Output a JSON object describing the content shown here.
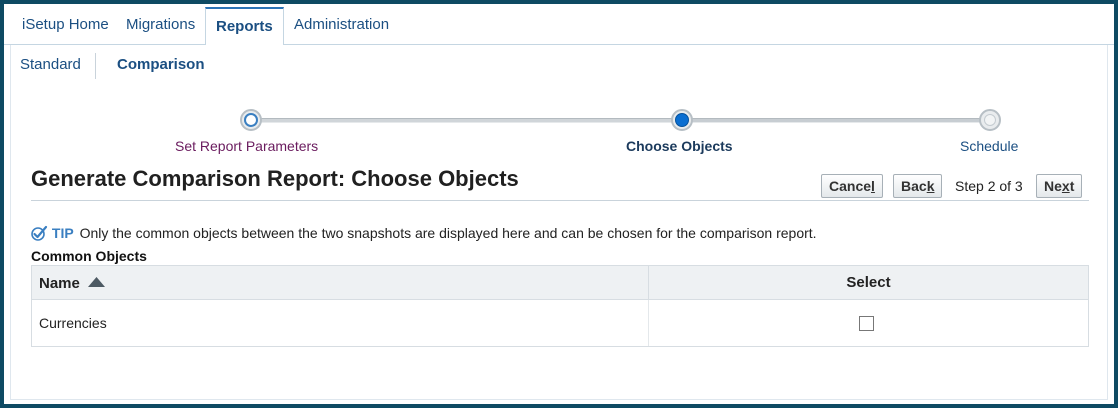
{
  "tabs": [
    {
      "label": "iSetup Home"
    },
    {
      "label": "Migrations"
    },
    {
      "label": "Reports",
      "active": true
    },
    {
      "label": "Administration"
    }
  ],
  "subtabs": [
    {
      "label": "Standard"
    },
    {
      "label": "Comparison",
      "active": true
    }
  ],
  "train": {
    "steps": [
      {
        "label": "Set Report Parameters",
        "state": "visited"
      },
      {
        "label": "Choose Objects",
        "state": "current"
      },
      {
        "label": "Schedule",
        "state": "future"
      }
    ]
  },
  "page": {
    "title": "Generate Comparison Report: Choose Objects",
    "buttons": {
      "cancel_main": "Cance",
      "cancel_key": "l",
      "back_main": "Bac",
      "back_key": "k",
      "next_main": "Ne",
      "next_key": "x",
      "next_tail": "t"
    },
    "step_text": "Step 2 of 3"
  },
  "tip": {
    "label": "TIP",
    "text": "Only the common objects between the two snapshots are displayed here and can be chosen for the comparison report."
  },
  "common_objects": {
    "title": "Common Objects",
    "columns": {
      "name": "Name",
      "select": "Select"
    },
    "rows": [
      {
        "name": "Currencies",
        "selected": false
      }
    ]
  },
  "colors": {
    "frame": "#0e4a63",
    "link": "#1b4f82",
    "visited_step": "#6a1b5e",
    "current_step": "#0a6ed1"
  },
  "icons": {
    "tip": "checkmark-tip-icon",
    "sort": "sort-ascending-icon"
  }
}
